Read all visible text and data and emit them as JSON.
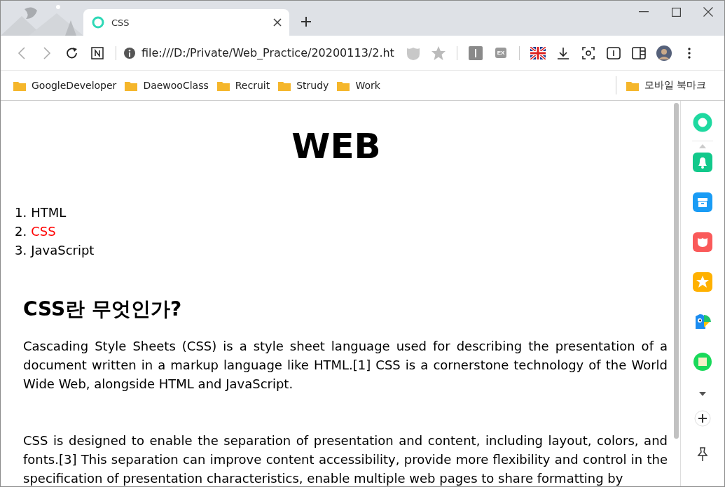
{
  "tabs": [
    {
      "title": "CSS",
      "selected": true
    }
  ],
  "address": "file:///D:/Private/Web_Practice/20200113/2.ht",
  "extension_badge": "EX",
  "bookmarks": [
    {
      "label": "GoogleDeveloper"
    },
    {
      "label": "DaewooClass"
    },
    {
      "label": "Recruit"
    },
    {
      "label": "Strudy"
    },
    {
      "label": "Work"
    }
  ],
  "mobile_bookmarks": "모바일 북마크",
  "page": {
    "title": "WEB",
    "nav": [
      {
        "number": "1.",
        "label": "HTML",
        "selected": false
      },
      {
        "number": "2.",
        "label": "CSS",
        "selected": true
      },
      {
        "number": "3.",
        "label": "JavaScript",
        "selected": false
      }
    ],
    "heading": "CSS란 무엇인가?",
    "paragraphs": [
      "Cascading Style Sheets (CSS) is a style sheet language used for describing the presentation of a document written in a markup language like HTML.[1] CSS is a cornerstone technology of the World Wide Web, alongside HTML and JavaScript.",
      "CSS is designed to enable the separation of presentation and content, including layout, colors, and fonts.[3] This separation can improve content accessibility, provide more flexibility and control in the specification of presentation characteristics, enable multiple web pages to share formatting by"
    ]
  },
  "side_panel": [
    {
      "kind": "ring",
      "color": "#1ed9a0"
    },
    {
      "kind": "bell",
      "color": "#12c98b"
    },
    {
      "kind": "archive",
      "color": "#1a9cf5"
    },
    {
      "kind": "pocket",
      "color": "#fa5a5a"
    },
    {
      "kind": "star",
      "color": "#ffb100"
    },
    {
      "kind": "bird",
      "color": "#1a8cf0"
    },
    {
      "kind": "note",
      "color": "#19d95a"
    }
  ]
}
